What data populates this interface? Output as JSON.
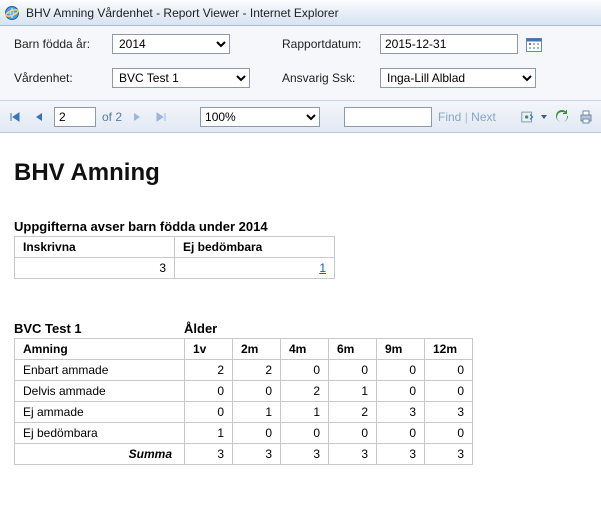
{
  "window": {
    "title": "BHV Amning Vårdenhet - Report Viewer - Internet Explorer"
  },
  "filters": {
    "year_label": "Barn födda år:",
    "year_value": "2014",
    "date_label": "Rapportdatum:",
    "date_value": "2015-12-31",
    "unit_label": "Vårdenhet:",
    "unit_value": "BVC Test 1",
    "nurse_label": "Ansvarig Ssk:",
    "nurse_value": "Inga-Lill Alblad"
  },
  "toolbar": {
    "page": "2",
    "of_label": "of 2",
    "zoom": "100%",
    "find_value": "",
    "find_label": "Find",
    "next_label": "Next"
  },
  "report": {
    "title": "BHV Amning",
    "subhead": "Uppgifterna avser barn födda under 2014",
    "table1": {
      "headers": [
        "Inskrivna",
        "Ej bedömbara"
      ],
      "values": [
        "3",
        "1"
      ]
    },
    "table2": {
      "unit": "BVC Test 1",
      "age_header": "Ålder",
      "row_header": "Amning",
      "cols": [
        "1v",
        "2m",
        "4m",
        "6m",
        "9m",
        "12m"
      ],
      "rows": [
        {
          "label": "Enbart ammade",
          "v": [
            2,
            2,
            0,
            0,
            0,
            0
          ]
        },
        {
          "label": "Delvis ammade",
          "v": [
            0,
            0,
            2,
            1,
            0,
            0
          ]
        },
        {
          "label": "Ej ammade",
          "v": [
            0,
            1,
            1,
            2,
            3,
            3
          ]
        },
        {
          "label": "Ej bedömbara",
          "v": [
            1,
            0,
            0,
            0,
            0,
            0
          ]
        }
      ],
      "sum_label": "Summa",
      "sum": [
        3,
        3,
        3,
        3,
        3,
        3
      ]
    }
  }
}
